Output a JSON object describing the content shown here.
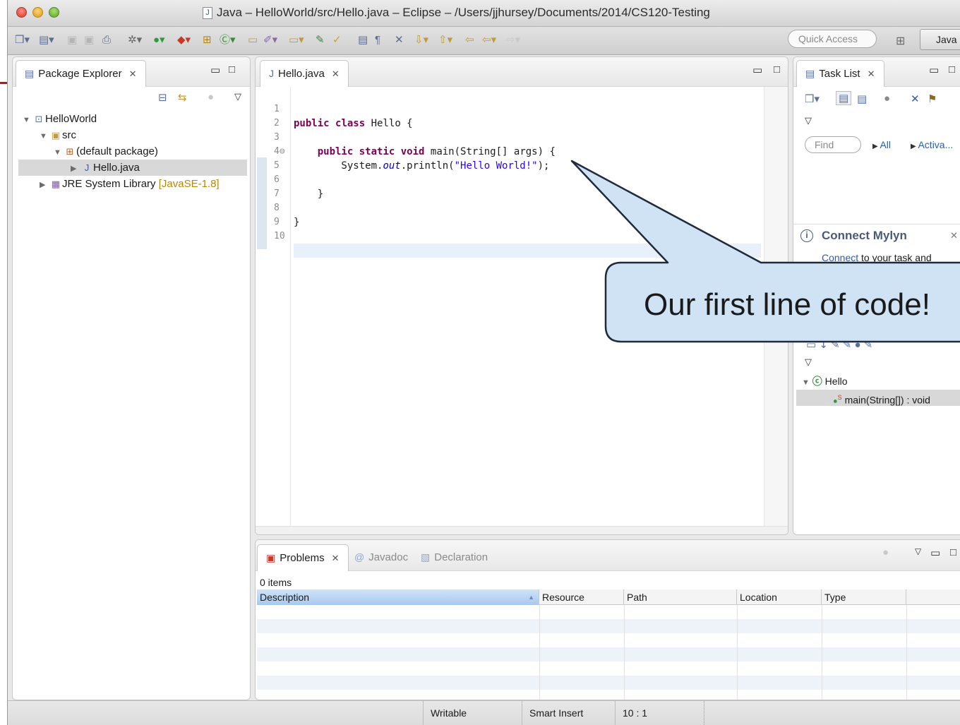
{
  "window": {
    "title": "Java – HelloWorld/src/Hello.java – Eclipse – /Users/jjhursey/Documents/2014/CS120-Testing"
  },
  "toolbar": {
    "quick_access_placeholder": "Quick Access",
    "perspective_label": "Java"
  },
  "package_explorer": {
    "tab_label": "Package Explorer",
    "tree": [
      {
        "label": "HelloWorld",
        "icon": "project-icon"
      },
      {
        "label": "src",
        "icon": "source-folder-icon"
      },
      {
        "label": "(default package)",
        "icon": "package-icon"
      },
      {
        "label": "Hello.java",
        "icon": "java-file-icon"
      },
      {
        "label": "JRE System Library",
        "decoration": "[JavaSE-1.8]",
        "icon": "library-icon"
      }
    ]
  },
  "editor": {
    "tab_label": "Hello.java",
    "line_numbers": [
      "1",
      "2",
      "3",
      "4⊖",
      "5",
      "6",
      "7",
      "8",
      "9",
      "10"
    ]
  },
  "task_list": {
    "tab_label": "Task List",
    "find_placeholder": "Find",
    "filter_all": "All",
    "filter_activate": "Activa..."
  },
  "mylyn": {
    "title": "Connect Mylyn",
    "link": "Connect",
    "text": "to your task and"
  },
  "outline": {
    "class_name": "Hello",
    "method": "main(String[]) : void"
  },
  "bottom_panel": {
    "tabs": [
      "Problems",
      "Javadoc",
      "Declaration"
    ],
    "items_count": "0 items",
    "columns": [
      "Description",
      "Resource",
      "Path",
      "Location",
      "Type"
    ]
  },
  "status_bar": {
    "writable": "Writable",
    "insert_mode": "Smart Insert",
    "position": "10 : 1"
  },
  "callout": {
    "text": "Our first line of code!"
  },
  "colors": {
    "keyword": "#7f0055",
    "string": "#2a00ff",
    "field": "#0000c0",
    "link": "#2a5db0"
  }
}
